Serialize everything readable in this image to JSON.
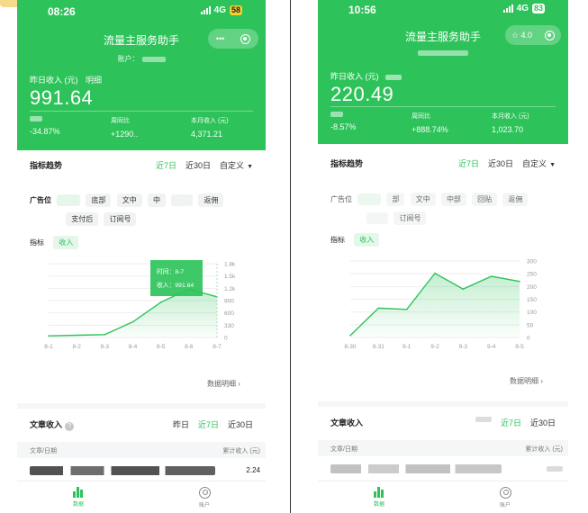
{
  "left": {
    "status": {
      "time": "08:26",
      "network": "4G",
      "battery": "58"
    },
    "app_title": "流量主服务助手",
    "account_label": "账户：",
    "yesterday_label": "昨日收入 (元)",
    "detail_label": "明细",
    "amount": "991.64",
    "stats": [
      {
        "label": "",
        "value": "-34.87%"
      },
      {
        "label": "周同比",
        "value": "+1290.."
      },
      {
        "label": "本月收入 (元)",
        "value": "4,371.21"
      }
    ],
    "trend_label": "指标趋势",
    "tabs": [
      "近7日",
      "近30日",
      "自定义"
    ],
    "filter_label": "广告位",
    "filters": [
      "底部",
      "文中",
      "中",
      "返佣",
      "支付后",
      "订阅号"
    ],
    "metric_label": "指标",
    "metric_value": "收入",
    "tooltip_time": "时间：8-7",
    "tooltip_income": "收入：991.64",
    "data_detail": "数据明细",
    "article_label": "文章收入",
    "article_tabs": [
      "昨日",
      "近7日",
      "近30日"
    ],
    "table_header": [
      "文章/日期",
      "累计收入 (元)"
    ],
    "row_value": "2.24",
    "tabbar": [
      "数据",
      "账户"
    ]
  },
  "right": {
    "status": {
      "time": "10:56",
      "network": "4G",
      "battery": "83"
    },
    "app_title": "流量主服务助手",
    "capsule_label": "4.0",
    "yesterday_label": "昨日收入 (元)",
    "amount": "220.49",
    "stats": [
      {
        "label": "",
        "value": "-8.57%"
      },
      {
        "label": "周同比",
        "value": "+888.74%"
      },
      {
        "label": "本月收入 (元)",
        "value": "1,023.70"
      }
    ],
    "trend_label": "指标趋势",
    "tabs": [
      "近7日",
      "近30日",
      "自定义"
    ],
    "filter_label": "广告位",
    "filters": [
      "部",
      "文中",
      "中部",
      "回贴",
      "返佣",
      "订阅号"
    ],
    "metric_label": "指标",
    "metric_value": "收入",
    "data_detail": "数据明细",
    "article_label": "文章收入",
    "article_tabs": [
      "近7日",
      "近30日"
    ],
    "table_header": [
      "文章/日期",
      "累计收入 (元)"
    ],
    "tabbar": [
      "数据",
      "账户"
    ]
  },
  "chart_data": [
    {
      "type": "area",
      "x": [
        "8-1",
        "8-2",
        "8-3",
        "8-4",
        "8-5",
        "8-6",
        "8-7"
      ],
      "values": [
        40,
        55,
        70,
        380,
        860,
        1180,
        992
      ],
      "yticks": [
        "0",
        "330",
        "600",
        "900",
        "1.2k",
        "1.5k",
        "1.8k"
      ],
      "ylim": [
        0,
        1800
      ],
      "color": "#2ec35a"
    },
    {
      "type": "area",
      "x": [
        "8-30",
        "8-31",
        "9-1",
        "9-2",
        "9-3",
        "9-4",
        "9-5"
      ],
      "values": [
        8,
        115,
        110,
        252,
        190,
        240,
        220
      ],
      "yticks": [
        "0",
        "50",
        "100",
        "150",
        "200",
        "250",
        "300"
      ],
      "ylim": [
        0,
        300
      ],
      "color": "#2ec35a"
    }
  ]
}
